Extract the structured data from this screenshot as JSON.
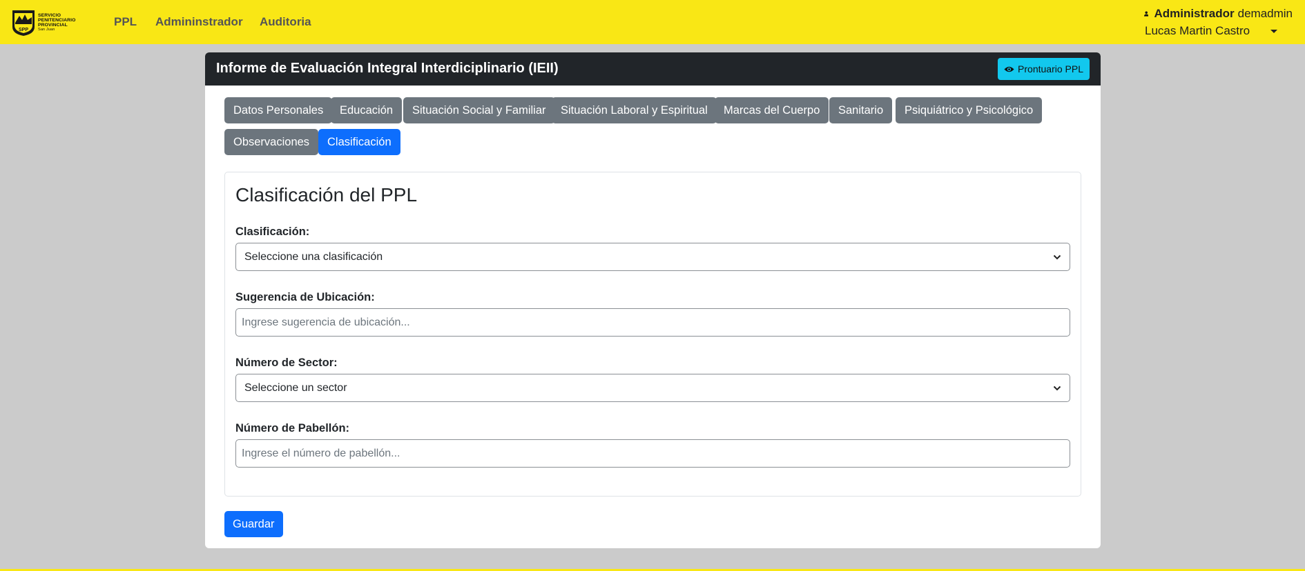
{
  "colors": {
    "navbar": "#f9e715",
    "card_header": "#212529",
    "primary": "#0d6efd",
    "secondary": "#6c757d",
    "info": "#12c8ee",
    "background": "#cbcbcb"
  },
  "logo": {
    "line1": "SERVICIO",
    "line2": "PENITENCIARIO",
    "line3": "PROVINCIAL",
    "line4": "San Juan",
    "badge": "SPP"
  },
  "nav": {
    "items": [
      {
        "label": "PPL"
      },
      {
        "label": "Admininstrador"
      },
      {
        "label": "Auditoria"
      }
    ]
  },
  "user": {
    "icon": "user-icon",
    "role": "Administrador",
    "username": "demadmin",
    "fullname": "Lucas Martin Castro"
  },
  "card": {
    "title": "Informe de Evaluación Integral Interdiciplinario (IEII)",
    "prontuario_label": "Prontuario PPL",
    "prontuario_icon": "eye-icon"
  },
  "tabs": [
    {
      "label": "Datos Personales"
    },
    {
      "label": "Educación"
    },
    {
      "label": "Situación Social y Familiar"
    },
    {
      "label": "Situación Laboral y Espiritual"
    },
    {
      "label": "Marcas del Cuerpo"
    },
    {
      "label": "Sanitario"
    },
    {
      "label": "Psiquiátrico y Psicológico"
    },
    {
      "label": "Observaciones"
    },
    {
      "label": "Clasificación",
      "active": true
    }
  ],
  "form": {
    "title": "Clasificación del PPL",
    "clasificacion": {
      "label": "Clasificación:",
      "value": "Seleccione una clasificación"
    },
    "ubicacion": {
      "label": "Sugerencia de Ubicación:",
      "placeholder": "Ingrese sugerencia de ubicación..."
    },
    "sector": {
      "label": "Número de Sector:",
      "value": "Seleccione un sector"
    },
    "pabellon": {
      "label": "Número de Pabellón:",
      "placeholder": "Ingrese el número de pabellón..."
    },
    "save_label": "Guardar"
  }
}
